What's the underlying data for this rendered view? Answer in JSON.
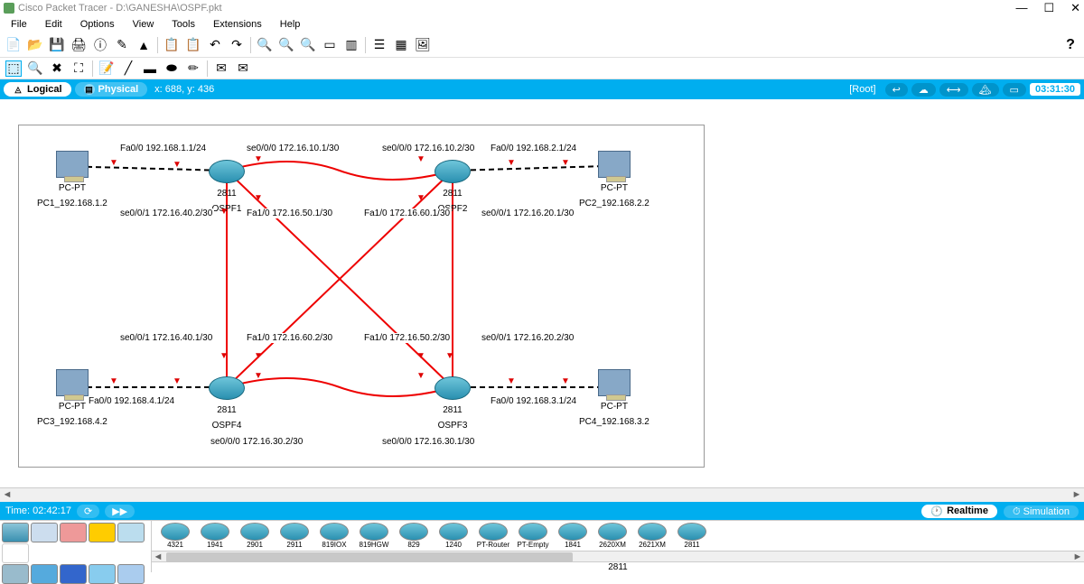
{
  "title": "Cisco Packet Tracer - D:\\GANESHA\\OSPF.pkt",
  "menu": [
    "File",
    "Edit",
    "Options",
    "View",
    "Tools",
    "Extensions",
    "Help"
  ],
  "view": {
    "logical": "Logical",
    "physical": "Physical",
    "coords": "x: 688, y: 436",
    "root": "[Root]",
    "clock": "03:31:30"
  },
  "timebar": {
    "label": "Time: 02:42:17",
    "rt": "Realtime",
    "sim": "Simulation"
  },
  "devices": {
    "pc1": {
      "t": "PC-PT",
      "n": "PC1_192.168.1.2"
    },
    "pc2": {
      "t": "PC-PT",
      "n": "PC2_192.168.2.2"
    },
    "pc3": {
      "t": "PC-PT",
      "n": "PC3_192.168.4.2"
    },
    "pc4": {
      "t": "PC-PT",
      "n": "PC4_192.168.3.2"
    },
    "r1": {
      "t": "2811",
      "n": "OSPF1"
    },
    "r2": {
      "t": "2811",
      "n": "OSPF2"
    },
    "r3": {
      "t": "2811",
      "n": "OSPF3"
    },
    "r4": {
      "t": "2811",
      "n": "OSPF4"
    }
  },
  "labels": {
    "pc1fa": "Fa0/0 192.168.1.1/24",
    "r1se": "se0/0/0 172.16.10.1/30",
    "r2se": "se0/0/0 172.16.10.2/30",
    "pc2fa": "Fa0/0 192.168.2.1/24",
    "r1se1": "se0/0/1 172.16.40.2/30",
    "r1fa1": "Fa1/0 172.16.50.1/30",
    "r2fa1": "Fa1/0 172.16.60.1/30",
    "r2se1": "se0/0/1 172.16.20.1/30",
    "r4se1": "se0/0/1 172.16.40.1/30",
    "r4fa1": "Fa1/0 172.16.60.2/30",
    "r3fa1": "Fa1/0 172.16.50.2/30",
    "r3se1": "se0/0/1 172.16.20.2/30",
    "pc3fa": "Fa0/0 192.168.4.1/24",
    "pc4fa": "Fa0/0 192.168.3.1/24",
    "r4se": "se0/0/0 172.16.30.2/30",
    "r3se": "se0/0/0 172.16.30.1/30"
  },
  "routerModels": [
    "4321",
    "1941",
    "2901",
    "2911",
    "819IOX",
    "819HGW",
    "829",
    "1240",
    "PT-Router",
    "PT-Empty",
    "1841",
    "2620XM",
    "2621XM",
    "2811"
  ],
  "selectedModel": "2811"
}
